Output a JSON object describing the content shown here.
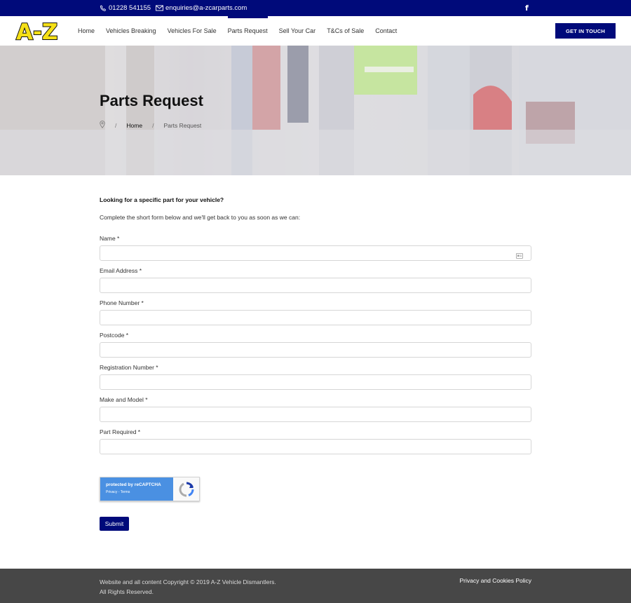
{
  "topbar": {
    "phone": "01228 541155",
    "email": "enquiries@a-zcarparts.com",
    "facebook": "f"
  },
  "header": {
    "logo_text": "A-Z",
    "nav": [
      {
        "label": "Home"
      },
      {
        "label": "Vehicles Breaking"
      },
      {
        "label": "Vehicles For Sale"
      },
      {
        "label": "Parts Request"
      },
      {
        "label": "Sell Your Car"
      },
      {
        "label": "T&Cs of Sale"
      },
      {
        "label": "Contact"
      }
    ],
    "cta": "GET IN TOUCH"
  },
  "hero": {
    "title": "Parts Request",
    "breadcrumb": {
      "sep": "/",
      "home": "Home",
      "current": "Parts Request"
    }
  },
  "form": {
    "intro_question": "Looking for a specific part for your vehicle?",
    "intro_text": "Complete the short form below and we'll get back to you as soon as we can:",
    "fields": [
      {
        "label": "Name *",
        "value": ""
      },
      {
        "label": "Email Address *",
        "value": ""
      },
      {
        "label": "Phone Number *",
        "value": ""
      },
      {
        "label": "Postcode *",
        "value": ""
      },
      {
        "label": "Registration Number *",
        "value": ""
      },
      {
        "label": "Make and Model *",
        "value": ""
      },
      {
        "label": "Part Required *",
        "value": ""
      }
    ],
    "recaptcha": {
      "line1": "protected by reCAPTCHA",
      "line2": "Privacy - Terms"
    },
    "submit": "Submit"
  },
  "footer": {
    "copyright_line1": "Website and all content Copyright © 2019 A-Z Vehicle Dismantlers.",
    "copyright_line2": "All Rights Reserved.",
    "policy_link": "Privacy and Cookies Policy"
  },
  "colors": {
    "brand_navy": "#000a7a",
    "logo_yellow": "#f5e016",
    "footer_bg": "#474747"
  }
}
